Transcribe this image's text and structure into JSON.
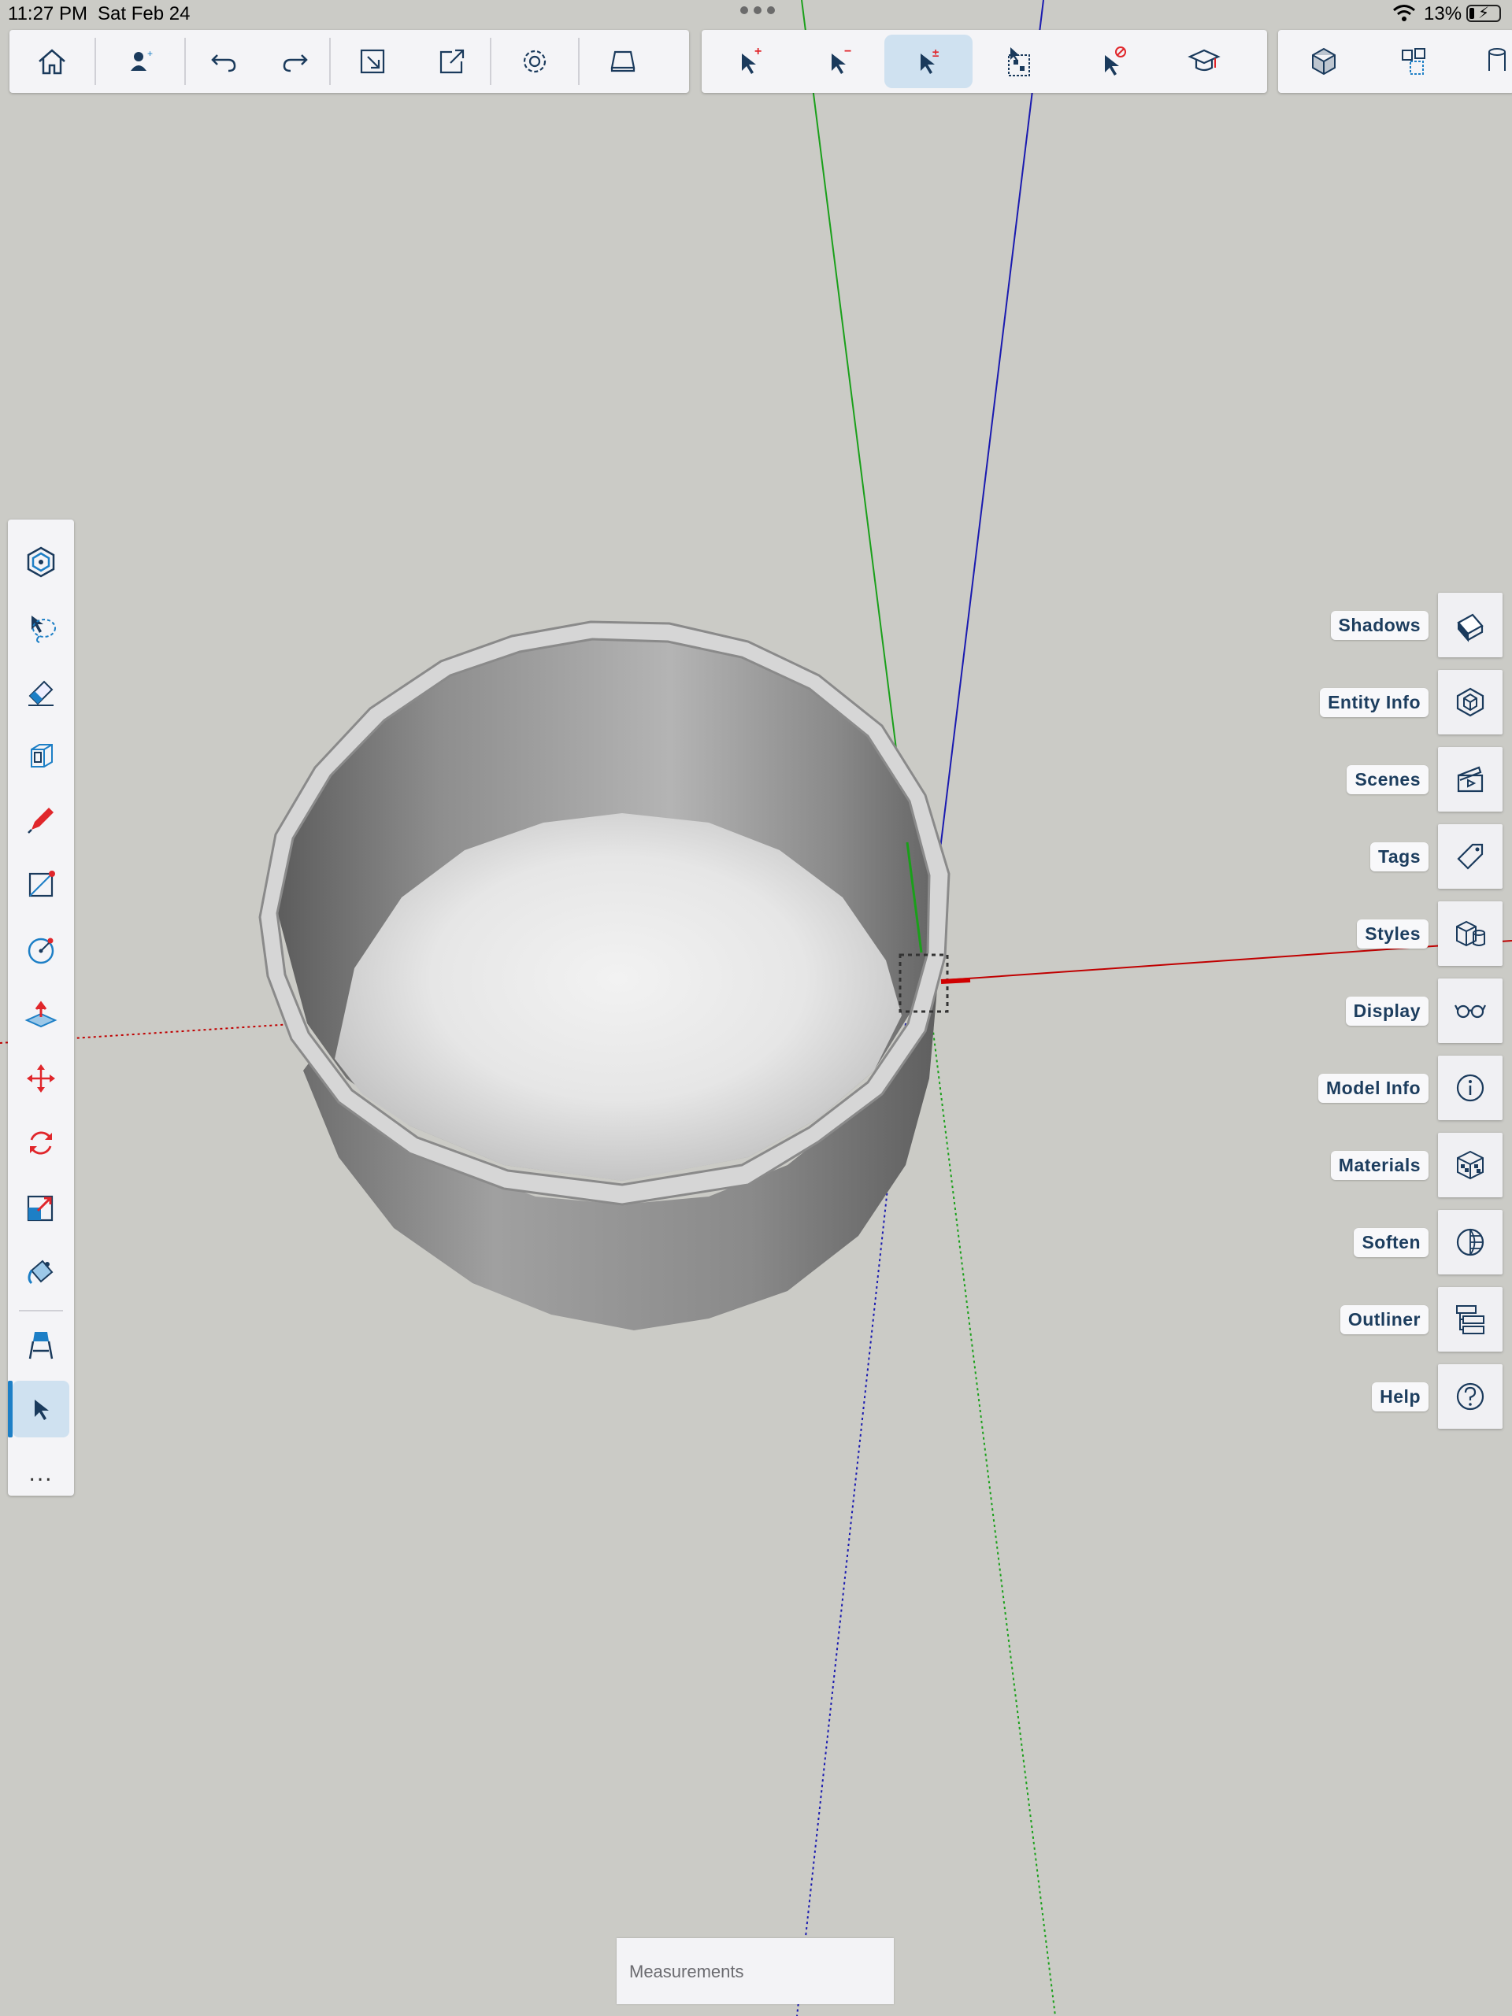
{
  "status_bar": {
    "time": "11:27 PM",
    "date": "Sat Feb 24",
    "battery": "13%"
  },
  "toolbar_main": {
    "icons": [
      "home-icon",
      "add-user-icon",
      "undo-icon",
      "redo-icon",
      "import-icon",
      "export-icon",
      "settings-icon",
      "view-icon"
    ]
  },
  "toolbar_select": {
    "icons": [
      "select-add-icon",
      "select-remove-icon",
      "select-toggle-icon",
      "select-all-icon",
      "select-none-icon",
      "instructor-icon"
    ],
    "active": "select-toggle-icon"
  },
  "toolbar_right": {
    "icons": [
      "component-icon",
      "components-icon",
      "cylinder-icon"
    ]
  },
  "tool_palette": {
    "icons": [
      "orbit-icon",
      "lasso-icon",
      "eraser-icon",
      "offset-icon",
      "pencil-icon",
      "rectangle-icon",
      "circle-icon",
      "push-pull-icon",
      "move-icon",
      "rotate-icon",
      "scale-icon",
      "paint-bucket-icon",
      "tape-measure-icon",
      "select-icon"
    ],
    "active": "select-icon",
    "more_label": "..."
  },
  "panels": [
    {
      "label": "Shadows",
      "icon": "shadows-icon"
    },
    {
      "label": "Entity Info",
      "icon": "entity-info-icon"
    },
    {
      "label": "Scenes",
      "icon": "scenes-icon"
    },
    {
      "label": "Tags",
      "icon": "tags-icon"
    },
    {
      "label": "Styles",
      "icon": "styles-icon"
    },
    {
      "label": "Display",
      "icon": "display-icon"
    },
    {
      "label": "Model Info",
      "icon": "model-info-icon"
    },
    {
      "label": "Materials",
      "icon": "materials-icon"
    },
    {
      "label": "Soften",
      "icon": "soften-icon"
    },
    {
      "label": "Outliner",
      "icon": "outliner-icon"
    },
    {
      "label": "Help",
      "icon": "help-icon"
    }
  ],
  "measurements": {
    "placeholder": "Measurements"
  },
  "colors": {
    "background": "#cbcbc6",
    "toolbar": "#f4f4f7",
    "accent": "#1d7fc6",
    "active_bg": "#cfe1f0",
    "axis_red": "#c00000",
    "axis_green": "#1aa01a",
    "axis_blue": "#1a1ab0",
    "icon_navy": "#1a3a5c",
    "icon_red": "#e0262b"
  }
}
